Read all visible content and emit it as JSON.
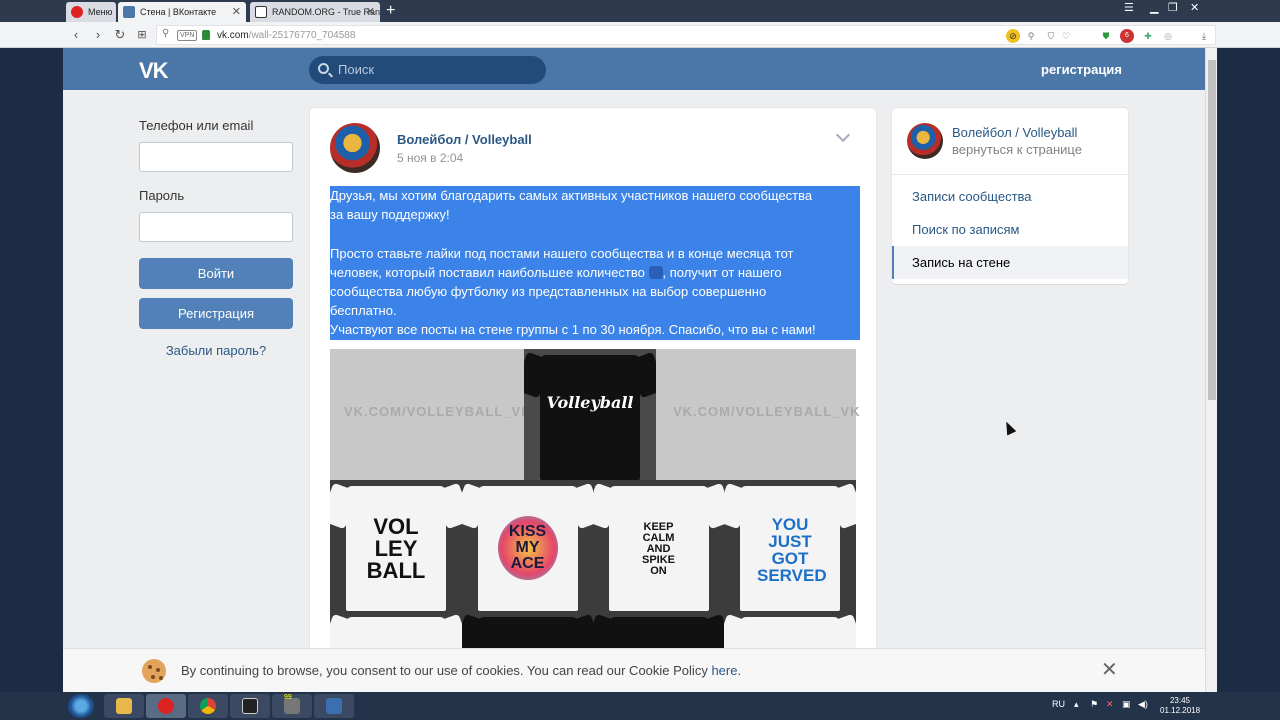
{
  "browser": {
    "tabs": [
      {
        "label": "Меню",
        "icon": "opera-icon"
      },
      {
        "label": "Стена | ВКонтакте",
        "icon": "vk-icon"
      },
      {
        "label": "RANDOM.ORG - True Ran",
        "icon": "random-org-icon"
      }
    ],
    "url_host": "vk.com",
    "url_path": "/wall-25176770_704588",
    "vpn_label": "VPN"
  },
  "vk_header": {
    "logo": "VK",
    "search_placeholder": "Поиск",
    "register_link": "регистрация"
  },
  "login": {
    "phone_label": "Телефон или email",
    "password_label": "Пароль",
    "login_button": "Войти",
    "register_button": "Регистрация",
    "forgot_link": "Забыли пароль?"
  },
  "post": {
    "author": "Волейбол / Volleyball",
    "date": "5 ноя в 2:04",
    "text_lines": [
      "Друзья, мы хотим благодарить самых активных участников нашего сообщества",
      "за вашу поддержку!",
      "",
      "Просто ставьте лайки под постами нашего сообщества и в конце месяца тот",
      "человек, который поставил наибольшее количество",
      ", получит от нашего",
      "сообщества любую футболку из представленных на выбор совершенно",
      "бесплатно.",
      "Участвуют все посты на стене группы с 1 по 30 ноября. Спасибо, что вы с нами!"
    ],
    "watermark": "VK.COM/VOLLEYBALL_VK",
    "shirt_prints": [
      "Volleyball",
      "VOL LEY BALL",
      "KISS MY ACE",
      "KEEP CALM AND SPIKE ON",
      "YOU JUST GOT SERVED"
    ]
  },
  "sidebar": {
    "group_title": "Волейбол / Volleyball",
    "back_link": "вернуться к странице",
    "items": [
      {
        "label": "Записи сообщества",
        "selected": false
      },
      {
        "label": "Поиск по записям",
        "selected": false
      },
      {
        "label": "Запись на стене",
        "selected": true
      }
    ]
  },
  "cookie": {
    "text": "By continuing to browse, you consent to our use of cookies. You can read our Cookie Policy ",
    "link": "here",
    "tail": "."
  },
  "taskbar": {
    "lang": "RU",
    "time": "23:45",
    "date": "01.12.2018",
    "badge": "99"
  },
  "colors": {
    "vk_blue": "#4a76a8",
    "link": "#2a5885",
    "selection": "#3b83e8"
  }
}
